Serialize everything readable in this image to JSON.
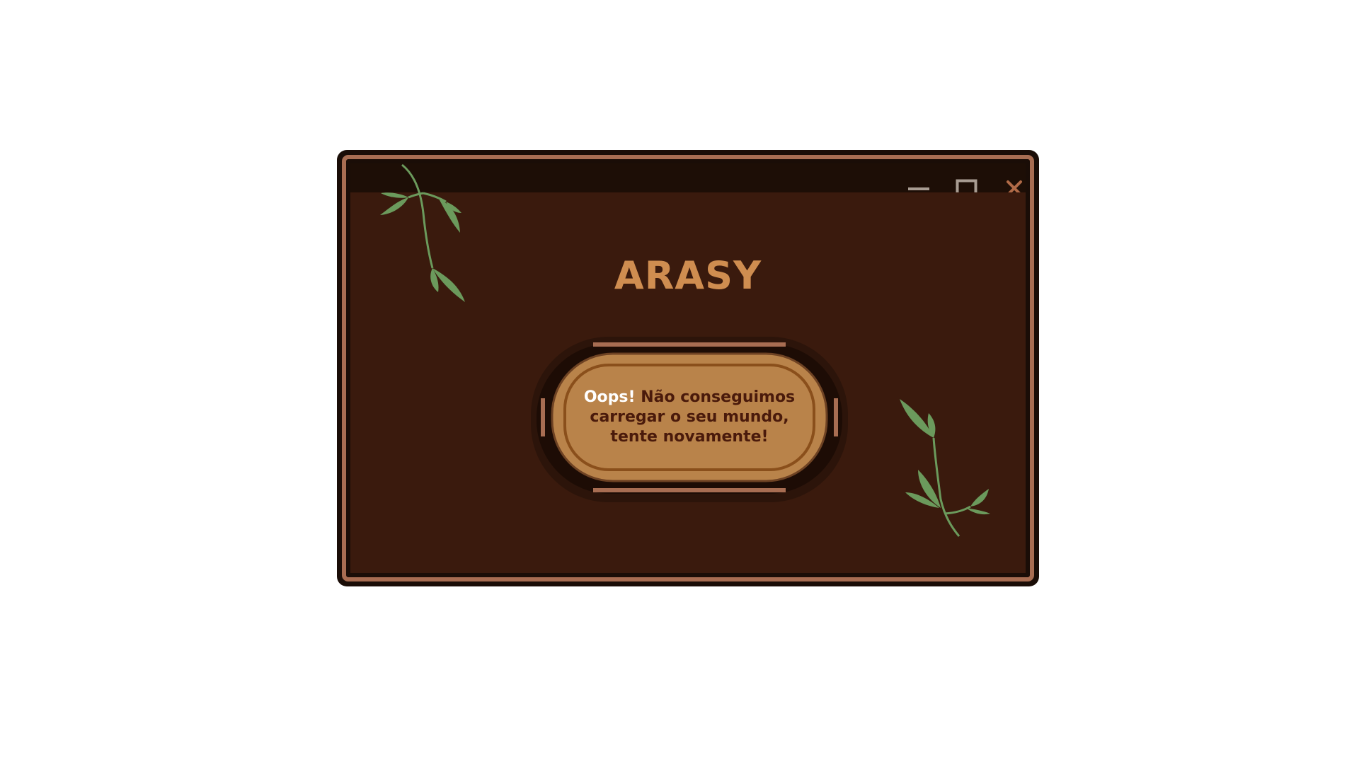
{
  "window": {
    "controls": {
      "minimize_icon": "minimize-icon",
      "maximize_icon": "maximize-icon",
      "close_icon": "close-icon"
    }
  },
  "app": {
    "title": "ARASY"
  },
  "error_dialog": {
    "emphasis": "Oops!",
    "message": "Não conseguimos carregar o seu mundo, tente novamente!"
  },
  "colors": {
    "frame_outer": "#1a0d07",
    "frame_ring": "#a86d52",
    "background": "#3a1a0d",
    "titlebar": "#1d0e06",
    "title_text": "#cf8d50",
    "dialog_fill": "#b9834a",
    "dialog_border": "#8a4f1b",
    "dialog_text": "#4a1a0b",
    "leaf_green": "#6b9a5c",
    "close_icon": "#b06a47",
    "control_icon": "#a89c92"
  }
}
